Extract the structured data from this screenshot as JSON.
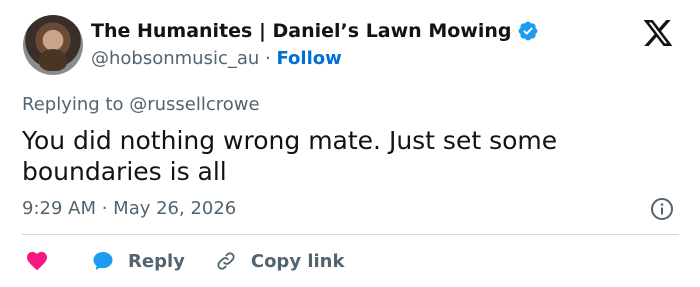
{
  "author": {
    "display_name": "The Humanites | Daniel’s Lawn Mowing",
    "handle": "@hobsonmusic_au",
    "separator": " · ",
    "follow_label": "Follow",
    "verified_color": "#1d9bf0"
  },
  "reply_context": {
    "prefix": "Replying to ",
    "mention": "@russellcrowe"
  },
  "tweet": {
    "text": "You did nothing wrong mate. Just set some boundaries is all",
    "time": "9:29 AM",
    "dot": " · ",
    "date": "May 26, 2026"
  },
  "actions": {
    "like_icon": "heart-icon",
    "like_color": "#f91880",
    "reply_label": "Reply",
    "reply_color": "#1d9bf0",
    "copy_link_label": "Copy link"
  },
  "icons": {
    "logo": "x-logo-icon",
    "info": "info-icon"
  }
}
